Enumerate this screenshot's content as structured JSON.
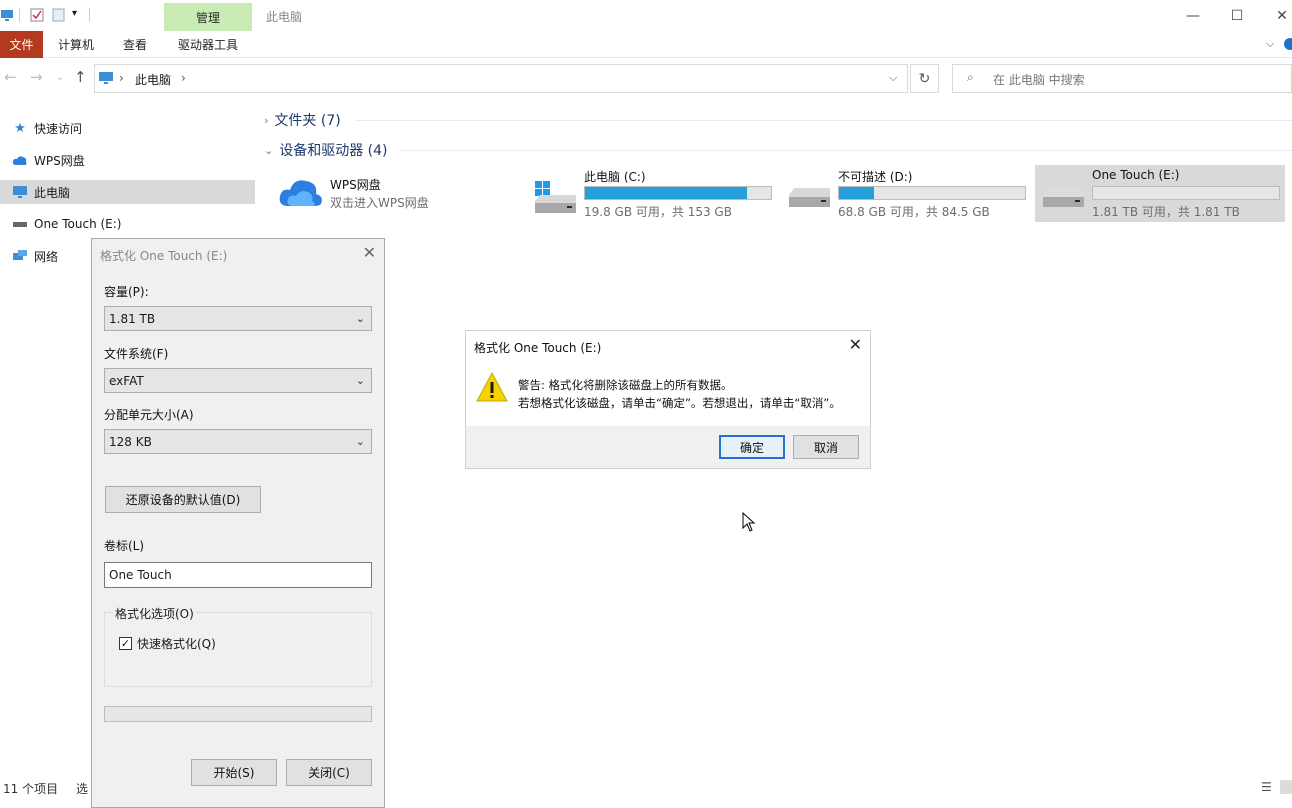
{
  "titlebar": {
    "contextual_tab": "管理",
    "window_title": "此电脑"
  },
  "ribbon": {
    "tabs": [
      "文件",
      "计算机",
      "查看",
      "驱动器工具"
    ]
  },
  "address": {
    "path_root": "此电脑",
    "separator": "›",
    "search_placeholder": "在 此电脑 中搜索"
  },
  "sidebar": {
    "items": [
      "快速访问",
      "WPS网盘",
      "此电脑",
      "One Touch (E:)",
      "网络"
    ],
    "selected": "此电脑"
  },
  "main": {
    "groups": {
      "folders": "文件夹 (7)",
      "drives": "设备和驱动器 (4)"
    },
    "drives": [
      {
        "name": "WPS网盘",
        "sub": "双击进入WPS网盘",
        "icon": "cloud-icon"
      },
      {
        "name": "此电脑 (C:)",
        "sub": "19.8 GB 可用，共 153 GB",
        "used_fraction": 0.87,
        "icon": "windows-drive-icon"
      },
      {
        "name": "不可描述 (D:)",
        "sub": "68.8 GB 可用，共 84.5 GB",
        "used_fraction": 0.19,
        "icon": "drive-icon"
      },
      {
        "name": "One Touch (E:)",
        "sub": "1.81 TB 可用，共 1.81 TB",
        "used_fraction": 0.0,
        "icon": "drive-icon"
      }
    ]
  },
  "status": {
    "items_count": "11 个项目",
    "selected_fragment": "选"
  },
  "format_dialog": {
    "title": "格式化 One Touch (E:)",
    "capacity_label": "容量(P):",
    "capacity_value": "1.81 TB",
    "fs_label": "文件系统(F)",
    "fs_value": "exFAT",
    "alloc_label": "分配单元大小(A)",
    "alloc_value": "128 KB",
    "restore_button": "还原设备的默认值(D)",
    "volume_label": "卷标(L)",
    "volume_value": "One Touch",
    "options_title": "格式化选项(O)",
    "quick_format": "快速格式化(Q)",
    "quick_format_checked": true,
    "progress": 0,
    "start_button": "开始(S)",
    "close_button": "关闭(C)"
  },
  "warning_dialog": {
    "title": "格式化 One Touch (E:)",
    "line1": "警告: 格式化将删除该磁盘上的所有数据。",
    "line2": "若想格式化该磁盘，请单击“确定”。若想退出，请单击“取消”。",
    "ok_button": "确定",
    "cancel_button": "取消"
  },
  "colors": {
    "file_tab": "#b33a1f",
    "manage_tab": "#c9ecb4",
    "drive_bar": "#26a0da",
    "warning": "#f5d300"
  }
}
